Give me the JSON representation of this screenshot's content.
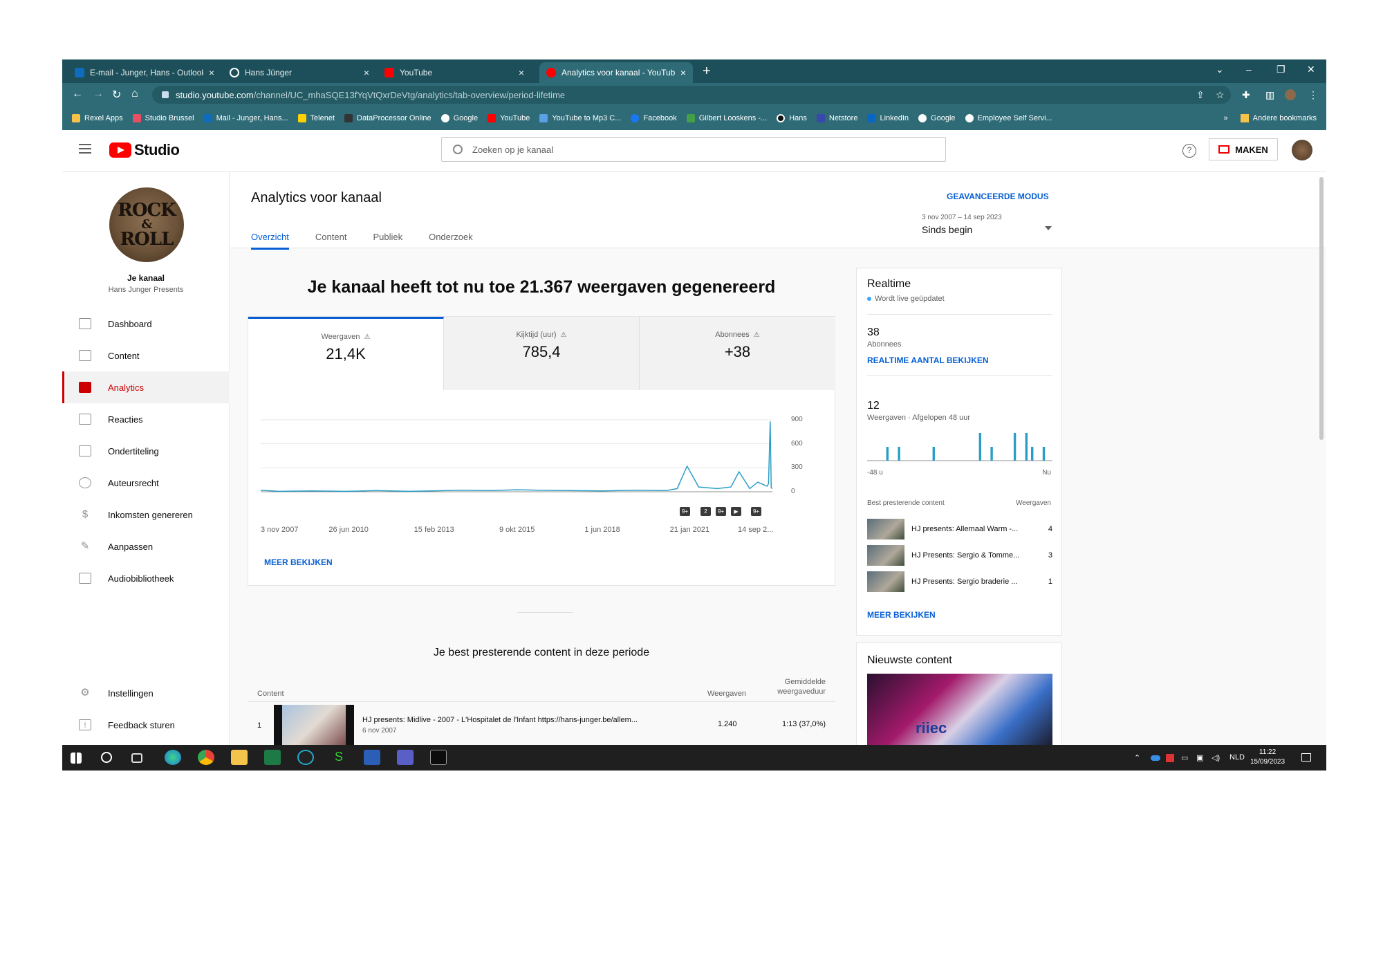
{
  "browser": {
    "tabs": [
      {
        "label": "E-mail - Junger, Hans - Outlook",
        "icon": "outlook-icon",
        "color": "#0f6cbd"
      },
      {
        "label": "Hans Jünger",
        "icon": "threads-icon",
        "color": "#111111"
      },
      {
        "label": "YouTube",
        "icon": "youtube-icon",
        "color": "#ff0000"
      },
      {
        "label": "Analytics voor kanaal - YouTube",
        "icon": "youtube-studio-icon",
        "color": "#ff0000"
      }
    ],
    "url_host": "studio.youtube.com",
    "url_path": "/channel/UC_mhaSQE13fYqVtQxrDeVtg/analytics/tab-overview/period-lifetime",
    "bookmarks": [
      {
        "label": "Rexel Apps",
        "color": "#f6c24a"
      },
      {
        "label": "Studio Brussel",
        "color": "#e94f64"
      },
      {
        "label": "Mail - Junger, Hans...",
        "color": "#0f6cbd"
      },
      {
        "label": "Telenet",
        "color": "#ffd100"
      },
      {
        "label": "DataProcessor Online",
        "color": "#333333"
      },
      {
        "label": "Google",
        "color": "#ffffff"
      },
      {
        "label": "YouTube",
        "color": "#ff0000"
      },
      {
        "label": "YouTube to Mp3 C...",
        "color": "#5aa0e6"
      },
      {
        "label": "Facebook",
        "color": "#1877f2"
      },
      {
        "label": "Gilbert Looskens -...",
        "color": "#43a047"
      },
      {
        "label": "Hans",
        "color": "#111111"
      },
      {
        "label": "Netstore",
        "color": "#3949ab"
      },
      {
        "label": "LinkedIn",
        "color": "#0a66c2"
      },
      {
        "label": "Google",
        "color": "#ffffff"
      },
      {
        "label": "Employee Self Servi...",
        "color": "#ffffff"
      }
    ],
    "bookmarks_overflow": "»",
    "other_bookmarks": "Andere bookmarks"
  },
  "header": {
    "logo_text": "Studio",
    "search_placeholder": "Zoeken op je kanaal",
    "help": "?",
    "create_label": "MAKEN"
  },
  "sidebar": {
    "avatar_text": [
      "ROCK",
      "&",
      "ROLL"
    ],
    "channel_title": "Je kanaal",
    "channel_name": "Hans Junger Presents",
    "items": [
      {
        "label": "Dashboard",
        "icon": "dashboard-icon"
      },
      {
        "label": "Content",
        "icon": "content-icon"
      },
      {
        "label": "Analytics",
        "icon": "analytics-icon"
      },
      {
        "label": "Reacties",
        "icon": "comments-icon"
      },
      {
        "label": "Ondertiteling",
        "icon": "subtitles-icon"
      },
      {
        "label": "Auteursrecht",
        "icon": "copyright-icon"
      },
      {
        "label": "Inkomsten genereren",
        "icon": "dollar-icon"
      },
      {
        "label": "Aanpassen",
        "icon": "magic-wand-icon"
      },
      {
        "label": "Audiobibliotheek",
        "icon": "audio-library-icon"
      }
    ],
    "bottom_items": [
      {
        "label": "Instellingen",
        "icon": "gear-icon"
      },
      {
        "label": "Feedback sturen",
        "icon": "feedback-icon"
      }
    ]
  },
  "analytics": {
    "title": "Analytics voor kanaal",
    "advanced_mode": "GEAVANCEERDE MODUS",
    "tabs": [
      "Overzicht",
      "Content",
      "Publiek",
      "Onderzoek"
    ],
    "date_range": "3 nov 2007 – 14 sep 2023",
    "date_label": "Sinds begin",
    "headline": "Je kanaal heeft tot nu toe 21.367 weergaven gegenereerd",
    "metrics": [
      {
        "label": "Weergaven",
        "value": "21,4K"
      },
      {
        "label": "Kijktijd (uur)",
        "value": "785,4"
      },
      {
        "label": "Abonnees",
        "value": "+38"
      }
    ],
    "markers": [
      "9+",
      "2",
      "9+",
      "▶",
      "9+"
    ],
    "see_more": "MEER BEKIJKEN"
  },
  "chart_data": {
    "type": "line",
    "title": "",
    "xlabel": "",
    "ylabel": "",
    "ylim": [
      0,
      900
    ],
    "y_ticks": [
      900,
      600,
      300,
      0
    ],
    "x_tick_labels": [
      "3 nov 2007",
      "26 jun 2010",
      "15 feb 2013",
      "9 okt 2015",
      "1 jun 2018",
      "21 jan 2021",
      "14 sep 2..."
    ],
    "series": [
      {
        "color": "#2a9dc6",
        "x": [
          "2007-11-03",
          "2008-06-01",
          "2009-06-01",
          "2010-06-26",
          "2011-06-01",
          "2012-06-01",
          "2013-02-15",
          "2014-01-01",
          "2015-01-01",
          "2015-10-09",
          "2016-06-01",
          "2017-06-01",
          "2018-06-01",
          "2019-06-01",
          "2020-06-01",
          "2020-10-01",
          "2021-01-21",
          "2021-06-01",
          "2022-01-01",
          "2022-06-01",
          "2022-09-01",
          "2023-01-01",
          "2023-04-01",
          "2023-06-01",
          "2023-07-15",
          "2023-08-01",
          "2023-08-20",
          "2023-09-01",
          "2023-09-14"
        ],
        "values": [
          20,
          5,
          10,
          5,
          15,
          5,
          10,
          20,
          15,
          25,
          20,
          15,
          10,
          20,
          15,
          40,
          320,
          60,
          40,
          60,
          250,
          40,
          120,
          90,
          70,
          100,
          880,
          50,
          40
        ]
      }
    ]
  },
  "top_content": {
    "title": "Je best presterende content in deze periode",
    "col_content": "Content",
    "col_views": "Weergaven",
    "col_avg": "Gemiddelde weergaveduur",
    "rows": [
      {
        "rank": "1",
        "title": "HJ presents: Midlive - 2007 - L'Hospitalet de l'Infant https://hans-junger.be/allem...",
        "date": "6 nov 2007",
        "views": "1.240",
        "avg": "1:13  (37,0%)"
      }
    ]
  },
  "realtime": {
    "title": "Realtime",
    "live": "Wordt live geüpdatet",
    "subs_value": "38",
    "subs_label": "Abonnees",
    "link": "REALTIME AANTAL BEKIJKEN",
    "views_value": "12",
    "views_label": "Weergaven · Afgelopen 48 uur",
    "axis_start": "-48 u",
    "axis_end": "Nu",
    "bars": [
      0,
      0,
      0,
      1,
      0,
      1,
      0,
      0,
      0,
      0,
      0,
      1,
      0,
      0,
      0,
      0,
      0,
      0,
      0,
      2,
      0,
      1,
      0,
      0,
      0,
      2,
      0,
      2,
      1,
      0,
      1,
      0
    ],
    "list_head_left": "Best presterende content",
    "list_head_right": "Weergaven",
    "items": [
      {
        "title": "HJ presents: Allemaal Warm -...",
        "views": "4"
      },
      {
        "title": "HJ Presents: Sergio & Tomme...",
        "views": "3"
      },
      {
        "title": "HJ Presents: Sergio braderie ...",
        "views": "1"
      }
    ],
    "see_more": "MEER BEKIJKEN"
  },
  "newest": {
    "title": "Nieuwste content",
    "thumb_text": "riiec"
  },
  "taskbar": {
    "lang": "NLD",
    "time": "11:22",
    "date": "15/09/2023"
  }
}
